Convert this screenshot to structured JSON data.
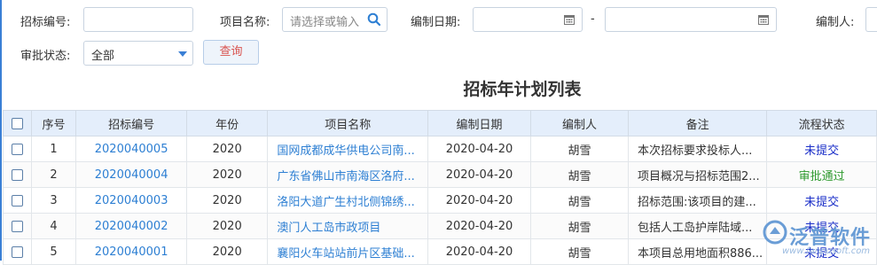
{
  "filters": {
    "bid_no_label": "招标编号:",
    "bid_no_value": "",
    "project_label": "项目名称:",
    "project_placeholder": "请选择或输入",
    "date_label": "编制日期:",
    "date_sep": "-",
    "author_label": "编制人:",
    "status_label": "审批状态:",
    "status_value": "全部",
    "query_button": "查询"
  },
  "title": "招标年计划列表",
  "table": {
    "columns": [
      "序号",
      "招标编号",
      "年份",
      "项目名称",
      "编制日期",
      "编制人",
      "备注",
      "流程状态"
    ],
    "rows": [
      {
        "no": "1",
        "bid": "2020040005",
        "year": "2020",
        "project": "国网成都成华供电公司南...",
        "date": "2020-04-20",
        "author": "胡雪",
        "note": "本次招标要求投标人...",
        "status": "未提交"
      },
      {
        "no": "2",
        "bid": "2020040004",
        "year": "2020",
        "project": "广东省佛山市南海区洛府...",
        "date": "2020-04-20",
        "author": "胡雪",
        "note": "项目概况与招标范围2...",
        "status": "审批通过"
      },
      {
        "no": "3",
        "bid": "2020040003",
        "year": "2020",
        "project": "洛阳大道广生村北侧锦绣...",
        "date": "2020-04-20",
        "author": "胡雪",
        "note": "招标范围:该项目的建...",
        "status": "未提交"
      },
      {
        "no": "4",
        "bid": "2020040002",
        "year": "2020",
        "project": "澳门人工岛市政项目",
        "date": "2020-04-20",
        "author": "胡雪",
        "note": "包括人工岛护岸陆域...",
        "status": "未提交"
      },
      {
        "no": "5",
        "bid": "2020040001",
        "year": "2020",
        "project": "襄阳火车站站前片区基础...",
        "date": "2020-04-20",
        "author": "胡雪",
        "note": "本项目总用地面积886...",
        "status": "未提交"
      }
    ]
  },
  "watermark": {
    "text": "泛普软件",
    "url": "www.fanpusoft.com"
  },
  "colors": {
    "link": "#2d7fd3",
    "pending": "#1a2ec8",
    "approved": "#2e9a2e",
    "header_bg": "#e4eefb"
  }
}
